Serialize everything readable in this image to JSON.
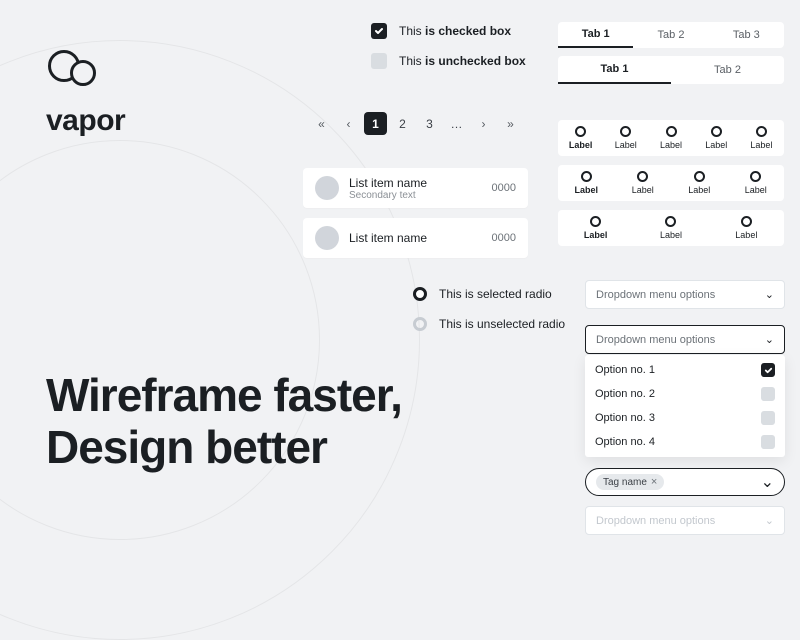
{
  "brand": "vapor",
  "hero": {
    "line1": "Wireframe faster,",
    "line2": "Design better"
  },
  "checkboxes": {
    "checked": {
      "prefix": "This ",
      "bold": "is checked box"
    },
    "unchecked": {
      "prefix": "This ",
      "bold": "is unchecked box"
    }
  },
  "pager": {
    "p1": "1",
    "p2": "2",
    "p3": "3",
    "ell": "…"
  },
  "list": {
    "item1": {
      "name": "List item name",
      "secondary": "Secondary text",
      "num": "0000"
    },
    "item2": {
      "name": "List item name",
      "num": "0000"
    }
  },
  "radios": {
    "selected": "This is selected radio",
    "unselected": "This is unselected radio"
  },
  "tabsA": {
    "t1": "Tab 1",
    "t2": "Tab 2",
    "t3": "Tab 3"
  },
  "tabsB": {
    "t1": "Tab 1",
    "t2": "Tab 2"
  },
  "labels": {
    "bold": "Label",
    "plain": "Label"
  },
  "dropdown": {
    "placeholder": "Dropdown menu options",
    "opt1": "Option no. 1",
    "opt2": "Option no. 2",
    "opt3": "Option no. 3",
    "opt4": "Option no. 4"
  },
  "tag": {
    "name": "Tag name"
  }
}
